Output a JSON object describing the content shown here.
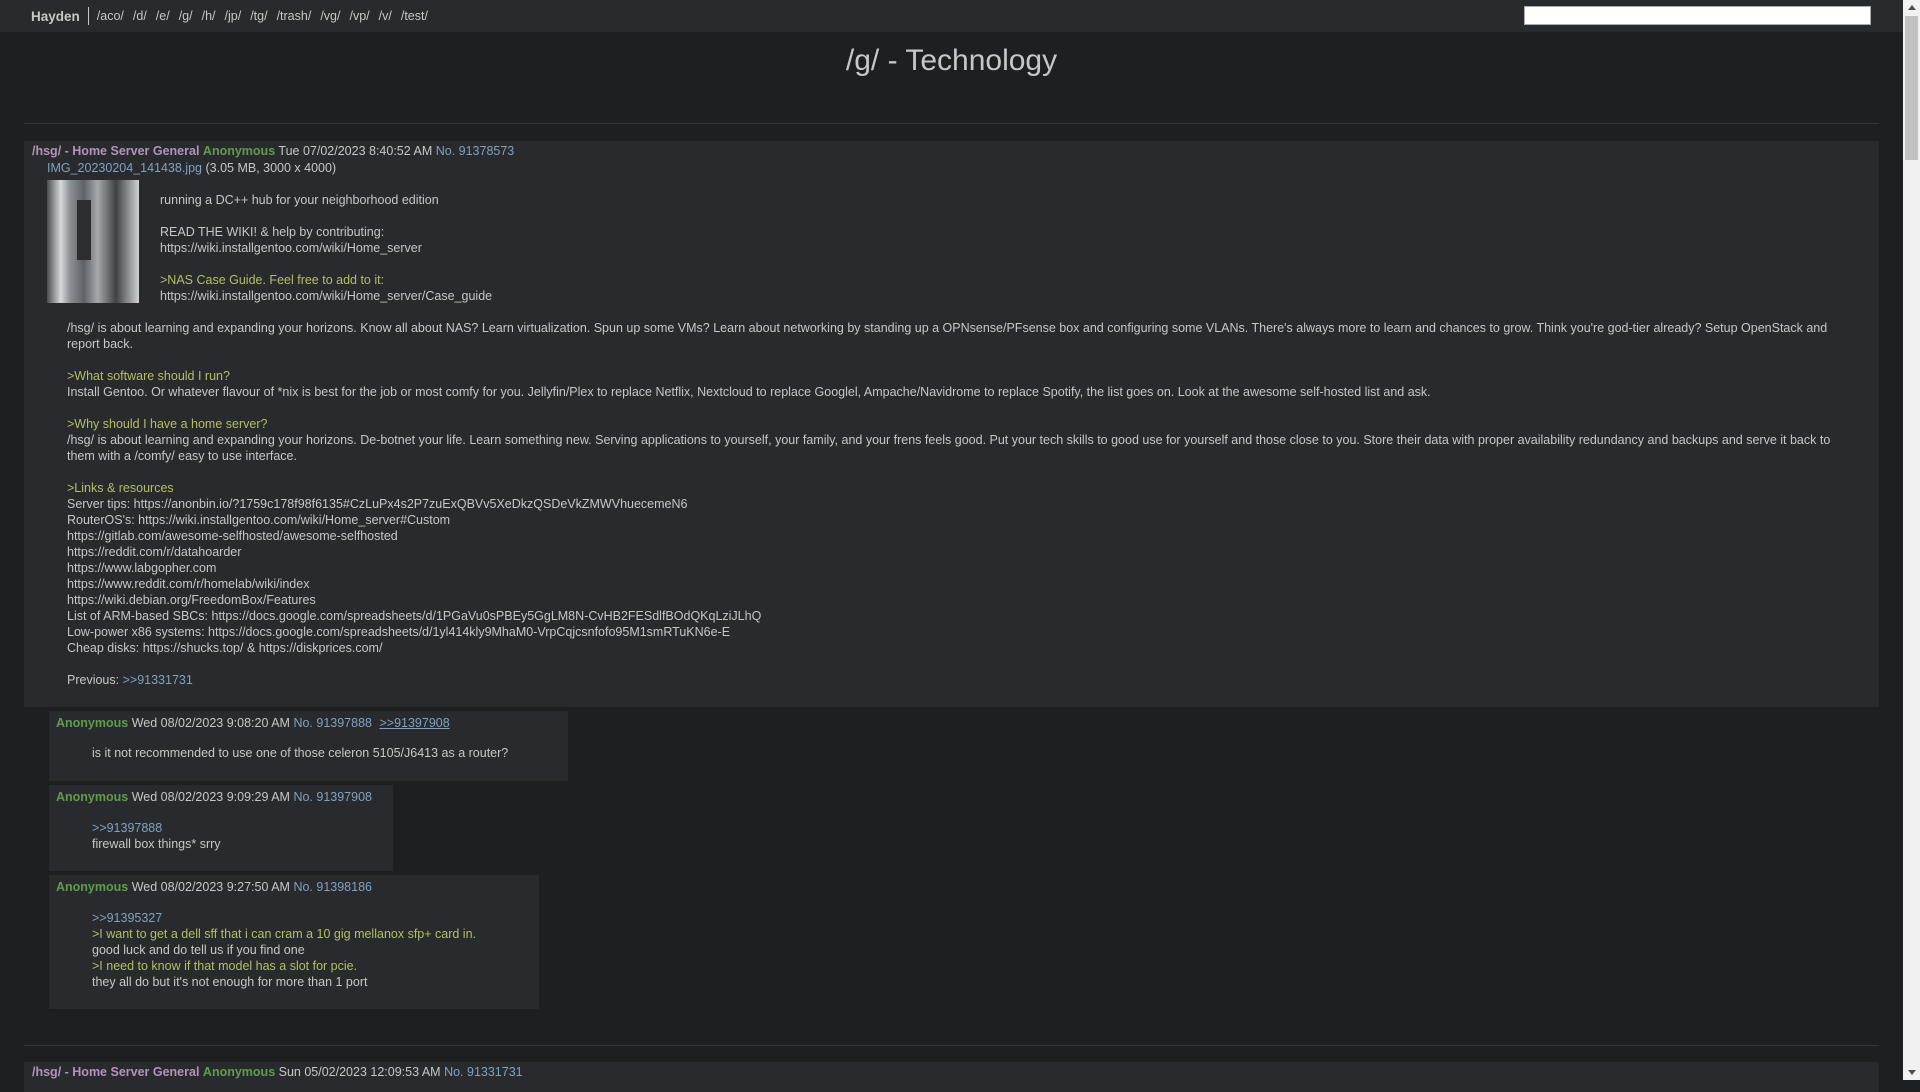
{
  "topbar": {
    "brand": "Hayden",
    "boards": [
      "/aco/",
      "/d/",
      "/e/",
      "/g/",
      "/h/",
      "/jp/",
      "/tg/",
      "/trash/",
      "/vg/",
      "/vp/",
      "/v/",
      "/test/"
    ],
    "search_value": ""
  },
  "board_title": "/g/ - Technology",
  "op": {
    "subject": "/hsg/ - Home Server General",
    "name": "Anonymous",
    "date": "Tue 07/02/2023 8:40:52 AM",
    "no": "No. 91378573",
    "file_name": "IMG_20230204_141438.jpg",
    "file_meta": "(3.05 MB, 3000 x 4000)",
    "top_lines": [
      {
        "text": "running a DC++ hub for your neighborhood edition",
        "type": "text"
      },
      {
        "text": "",
        "type": "gap"
      },
      {
        "text": "READ THE WIKI! & help by contributing:",
        "type": "text"
      },
      {
        "text": "https://wiki.installgentoo.com/wiki/Home_server",
        "type": "text"
      },
      {
        "text": "",
        "type": "gap"
      },
      {
        "text": ">NAS Case Guide. Feel free to add to it:",
        "type": "quote"
      },
      {
        "text": "https://wiki.installgentoo.com/wiki/Home_server/Case_guide",
        "type": "text"
      }
    ],
    "lines": [
      {
        "text": "/hsg/ is about learning and expanding your horizons. Know all about NAS? Learn virtualization. Spun up some VMs? Learn about networking by standing up a OPNsense/PFsense box and configuring some VLANs. There's always more to learn and chances to grow. Think you're god-tier already? Setup OpenStack and report back.",
        "type": "text"
      },
      {
        "text": "",
        "type": "gap"
      },
      {
        "text": ">What software should I run?",
        "type": "quote"
      },
      {
        "text": "Install Gentoo. Or whatever flavour of *nix is best for the job or most comfy for you. Jellyfin/Plex to replace Netflix, Nextcloud to replace Googlel, Ampache/Navidrome to replace Spotify, the list goes on. Look at the awesome self-hosted list and ask.",
        "type": "text"
      },
      {
        "text": "",
        "type": "gap"
      },
      {
        "text": ">Why should I have a home server?",
        "type": "quote"
      },
      {
        "text": "/hsg/ is about learning and expanding your horizons. De-botnet your life. Learn something new. Serving applications to yourself, your family, and your frens feels good. Put your tech skills to good use for yourself and those close to you. Store their data with proper availability redundancy and backups and serve it back to them with a /comfy/ easy to use interface.",
        "type": "text"
      },
      {
        "text": "",
        "type": "gap"
      },
      {
        "text": ">Links & resources",
        "type": "quote"
      },
      {
        "text": "Server tips: https://anonbin.io/?1759c178f98f6135#CzLuPx4s2P7zuExQBVv5XeDkzQSDeVkZMWVhuecemeN6",
        "type": "text"
      },
      {
        "text": "RouterOS's: https://wiki.installgentoo.com/wiki/Home_server#Custom",
        "type": "text"
      },
      {
        "text": "https://gitlab.com/awesome-selfhosted/awesome-selfhosted",
        "type": "text"
      },
      {
        "text": "https://reddit.com/r/datahoarder",
        "type": "text"
      },
      {
        "text": "https://www.labgopher.com",
        "type": "text"
      },
      {
        "text": "https://www.reddit.com/r/homelab/wiki/index",
        "type": "text"
      },
      {
        "text": "https://wiki.debian.org/FreedomBox/Features",
        "type": "text"
      },
      {
        "text": "List of ARM-based SBCs: https://docs.google.com/spreadsheets/d/1PGaVu0sPBEy5GgLM8N-CvHB2FESdlfBOdQKqLziJLhQ",
        "type": "text"
      },
      {
        "text": "Low-power x86 systems: https://docs.google.com/spreadsheets/d/1yl414kly9MhaM0-VrpCqjcsnfofo95M1smRTuKN6e-E",
        "type": "text"
      },
      {
        "text": "Cheap disks: https://shucks.top/ & https://diskprices.com/",
        "type": "text"
      }
    ],
    "previous_label": "Previous: ",
    "previous_link": ">>91331731"
  },
  "replies": [
    {
      "name": "Anonymous",
      "date": "Wed 08/02/2023 9:08:20 AM",
      "no": "No. 91397888",
      "backlink": ">>91397908",
      "lines": [
        {
          "text": "is it not recommended to use one of those celeron 5105/J6413 as a router?",
          "type": "text"
        }
      ]
    },
    {
      "name": "Anonymous",
      "date": "Wed 08/02/2023 9:09:29 AM",
      "no": "No. 91397908",
      "backlink": "",
      "lines": [
        {
          "text": ">>91397888",
          "type": "link"
        },
        {
          "text": "firewall box things* srry",
          "type": "text"
        }
      ]
    },
    {
      "name": "Anonymous",
      "date": "Wed 08/02/2023 9:27:50 AM",
      "no": "No. 91398186",
      "backlink": "",
      "lines": [
        {
          "text": ">>91395327",
          "type": "link"
        },
        {
          "text": ">I want to get a dell sff that i can cram a 10 gig mellanox sfp+ card in.",
          "type": "quote"
        },
        {
          "text": "good luck and do tell us if you find one",
          "type": "text"
        },
        {
          "text": ">I need to know if that model has a slot for pcie.",
          "type": "quote"
        },
        {
          "text": "they all do but it's not enough for more than 1 port",
          "type": "text"
        }
      ]
    }
  ],
  "op2": {
    "subject": "/hsg/ - Home Server General",
    "name": "Anonymous",
    "date": "Sun 05/02/2023 12:09:53 AM",
    "no": "No. 91331731"
  },
  "colors": {
    "background": "#1d1f21",
    "post_background": "#282a2e",
    "subject": "#b294bb",
    "name": "#5f9d4c",
    "quote": "#b5bd68",
    "link": "#81a2be"
  }
}
